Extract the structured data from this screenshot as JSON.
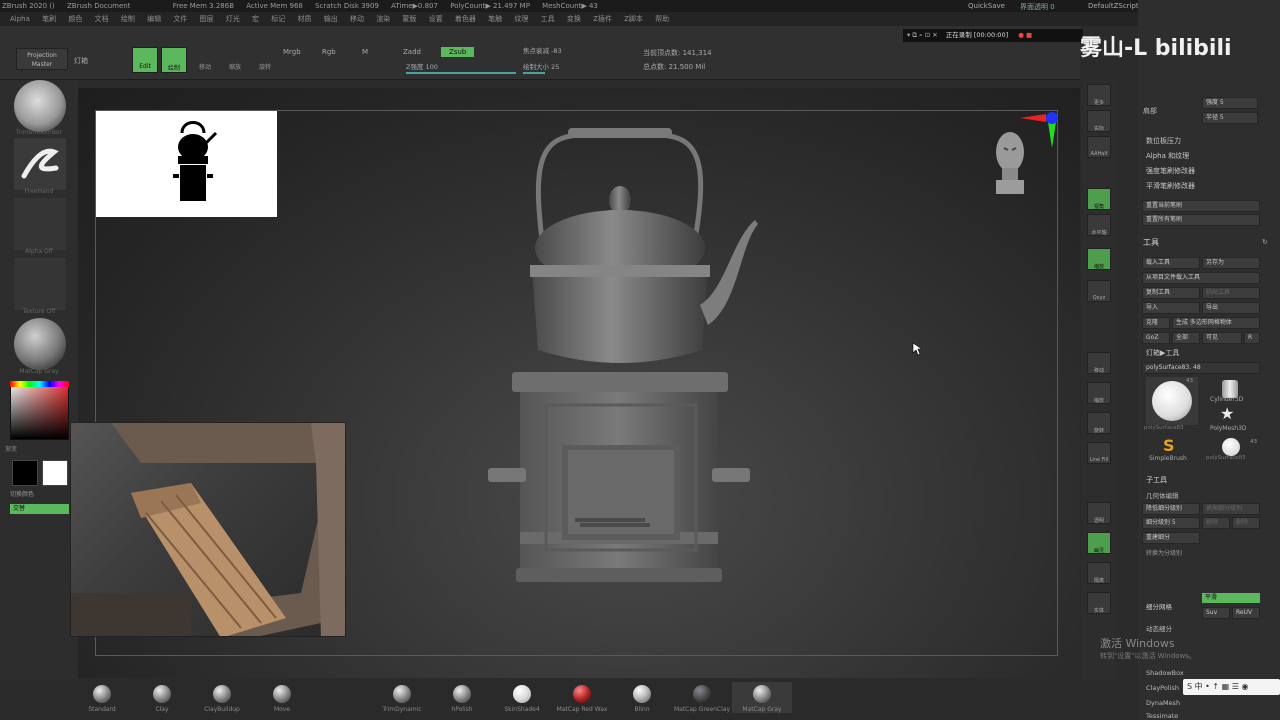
{
  "titlebar": {
    "app": "ZBrush 2020 ()",
    "document": "ZBrush Document",
    "free_mem": "Free Mem 3.286B",
    "active_mem": "Active Mem 968",
    "scratch": "Scratch Disk 3909",
    "atime": "ATime▶0.807",
    "polycount": "PolyCount▶ 21.497 MP",
    "meshcount": "MeshCount▶ 43",
    "quicksave": "QuickSave",
    "transparency": "界面透明 0",
    "script": "DefaultZScript"
  },
  "menubar": {
    "items": [
      "Alpha",
      "笔刷",
      "颜色",
      "文档",
      "绘制",
      "编辑",
      "文件",
      "图层",
      "灯光",
      "宏",
      "标记",
      "材质",
      "输出",
      "移动",
      "渲染",
      "蒙版",
      "设置",
      "着色器",
      "笔触",
      "纹理",
      "工具",
      "变换",
      "Z插件",
      "Z脚本",
      "帮助"
    ]
  },
  "shelf": {
    "projection_master": "Projection Master",
    "lightbox": "灯箱",
    "edit": "Edit",
    "draw": "绘制",
    "move": "移动",
    "scale": "缩放",
    "rotate": "旋转",
    "mrgb": "Mrgb",
    "rgb": "Rgb",
    "m": "M",
    "zadd": "Zadd",
    "zsub": "Zsub",
    "focal": "焦点衰减 -83",
    "zintensity": "Z强度 100",
    "draw_size": "绘制大小 25",
    "active_points": "当前顶点数: 141,314",
    "total_points": "总点数: 21.500 Mil"
  },
  "recorder": {
    "text": "正在录制 [00:00:00]"
  },
  "watermark": "雾山-L bilibili",
  "left_tray": {
    "brush_label": "TrimSmoothBor",
    "stroke_label": "FreeHand",
    "alpha_label": "Alpha Off",
    "texture_label": "Texture Off",
    "material_label": "MatCap Gray",
    "gradient_label": "渐变",
    "switch_label": "切换颜色",
    "alternate_label": "交替"
  },
  "right_strip": {
    "buttons": [
      "更多",
      "实际",
      "AAHalf",
      "视角",
      "水平轴",
      "缩放",
      "Qxyz",
      "移动",
      "缩放",
      "旋转",
      "Line Fill",
      "透明",
      "幽灵",
      "隔离",
      "实体"
    ]
  },
  "right_panel": {
    "sliders": [
      {
        "label": "肩部",
        "value": "强度 5"
      },
      {
        "label": "",
        "value": "半径 5"
      }
    ],
    "stroke_items": [
      "数位板压力",
      "Alpha 和纹理",
      "强度笔刷修改器",
      "平滑笔刷修改器"
    ],
    "reset_buttons": [
      "重置当前笔刷",
      "重置所有笔刷"
    ],
    "tool_header": "工具",
    "tool_buttons": [
      [
        "载入工具",
        "另存为"
      ],
      [
        "从项目文件载入工具"
      ],
      [
        "复制工具",
        "粘贴工具"
      ],
      [
        "导入",
        "导出"
      ],
      [
        "克隆",
        "生成 多边形网格物体"
      ],
      [
        "GoZ",
        "全部",
        "可见",
        "R"
      ]
    ],
    "lightbox_tools": "灯箱▶工具",
    "current_tool": "polySurface83. 48",
    "tool_thumbs": [
      {
        "name": "polySurface83",
        "count": "43"
      },
      {
        "name": "Cylinder3D",
        "count": ""
      },
      {
        "name": "PolyMesh3D",
        "count": ""
      },
      {
        "name": "SimpleBrush",
        "count": ""
      },
      {
        "name": "polySurface83",
        "count": "43"
      }
    ],
    "subtool_header": "子工具",
    "geometry_header": "几何体编辑",
    "geometry_buttons": [
      [
        "降低细分级别",
        "更高细分级别"
      ],
      [
        "细分级别 5",
        "删除",
        "删除"
      ],
      [
        "重建细分"
      ],
      [
        "转换为分级别"
      ]
    ],
    "divide_label": "细分网格",
    "smooth": "平滑",
    "suv": "Suv",
    "resuv": "ReUV",
    "dynamic_subdiv": "动态细分",
    "bottom_items": [
      "ShadowBox",
      "ClayPolish",
      "DynaMesh",
      "Tessimate"
    ]
  },
  "bottom_bar": {
    "brushes": [
      "Standard",
      "Clay",
      "ClayBuildup",
      "Move",
      "TrimDynamic",
      "hPolish",
      "SkinShade4",
      "MatCap Red Wax",
      "Blinn",
      "MatCap GreenClay",
      "MatCap Gray"
    ]
  },
  "windows_activation": {
    "line1": "激活 Windows",
    "line2": "转到\"设置\"以激活 Windows。"
  },
  "ime": "S 中 • ↑ ▦ ☰ ◉",
  "colors": {
    "accent_green": "#5cb85c",
    "canvas_dark": "#1e1e1e"
  }
}
